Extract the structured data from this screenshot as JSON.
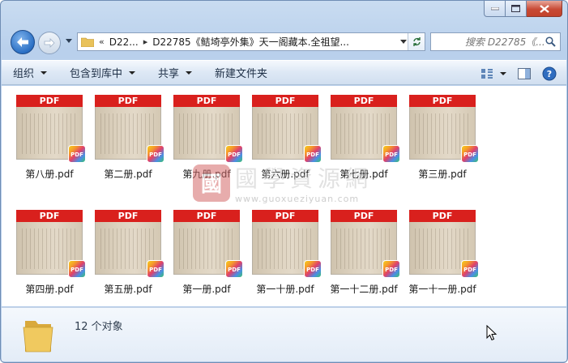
{
  "nav": {
    "breadcrumb_prefix": "«",
    "crumbs": [
      "D22...",
      "D22785《鲒埼亭外集》天一阁藏本.全祖望..."
    ],
    "search_placeholder": "搜索 D22785《..."
  },
  "toolbar": {
    "items": [
      "组织",
      "包含到库中",
      "共享",
      "新建文件夹"
    ]
  },
  "files": [
    {
      "name": "第八册.pdf"
    },
    {
      "name": "第二册.pdf"
    },
    {
      "name": "第九册.pdf"
    },
    {
      "name": "第六册.pdf"
    },
    {
      "name": "第七册.pdf"
    },
    {
      "name": "第三册.pdf"
    },
    {
      "name": "第四册.pdf"
    },
    {
      "name": "第五册.pdf"
    },
    {
      "name": "第一册.pdf"
    },
    {
      "name": "第一十册.pdf"
    },
    {
      "name": "第一十二册.pdf"
    },
    {
      "name": "第一十一册.pdf"
    }
  ],
  "thumbnail": {
    "banner": "PDF",
    "badge": "PDF"
  },
  "watermark": {
    "seal": "國",
    "text": "國學資源網",
    "url": "www.guoxueziyuan.com"
  },
  "status": {
    "count_text": "12 个对象"
  },
  "colors": {
    "pdf_red": "#d9201d",
    "window_blue": "#b9d0ec"
  }
}
